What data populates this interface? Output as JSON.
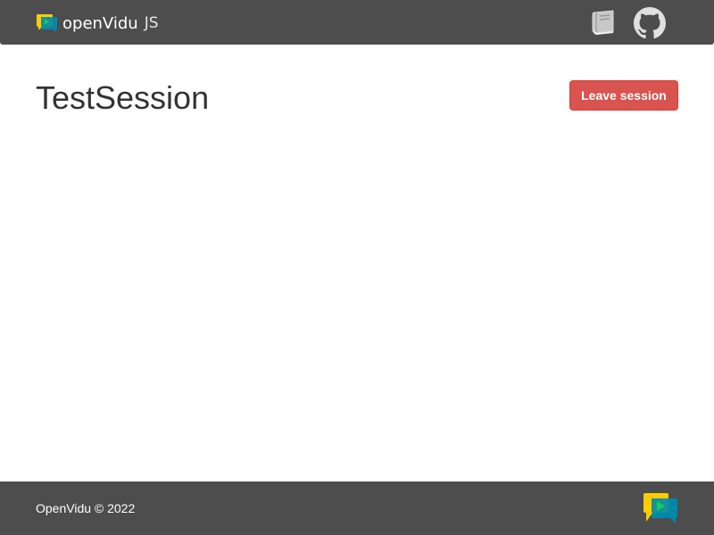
{
  "navbar": {
    "brand_name": "openVidu",
    "brand_suffix": "JS",
    "docs_icon": "book-icon",
    "github_icon": "github-icon"
  },
  "session": {
    "title": "TestSession",
    "leave_label": "Leave session"
  },
  "footer": {
    "copyright": "OpenVidu © 2022",
    "logo_icon": "openvidu-logo"
  },
  "colors": {
    "navbar_bg": "#4d4d4d",
    "footer_bg": "#4d4d4d",
    "leave_button": "#d9534f",
    "logo_yellow": "#ffcc00",
    "logo_teal": "#0088aa",
    "logo_green": "#06d362"
  }
}
